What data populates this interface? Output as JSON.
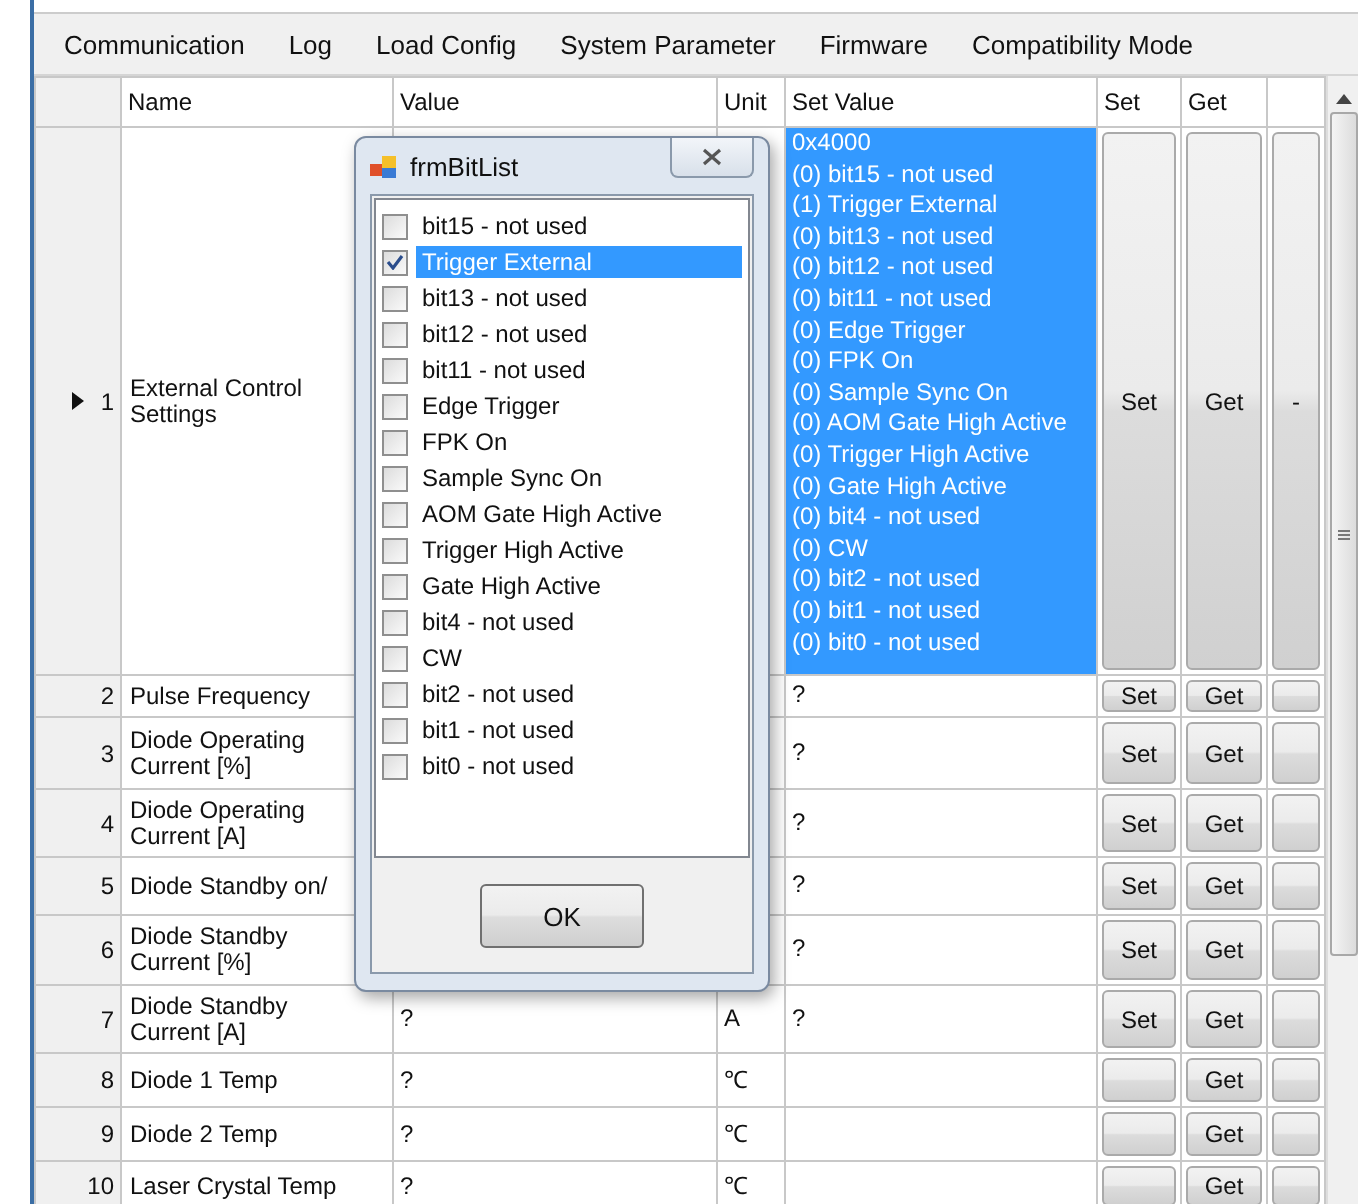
{
  "menu": [
    {
      "label": "Communication"
    },
    {
      "label": "Log"
    },
    {
      "label": "Load Config"
    },
    {
      "label": "System Parameter"
    },
    {
      "label": "Firmware"
    },
    {
      "label": "Compatibility Mode"
    }
  ],
  "table": {
    "columns": [
      "Name",
      "Value",
      "Unit",
      "Set Value",
      "Set",
      "Get"
    ],
    "rows": [
      {
        "number": "1",
        "name": "External Control Settings",
        "value": "",
        "unit": "",
        "set_value_lines": [
          "0x4000",
          "(0) bit15 - not used",
          "(1) Trigger External",
          "(0) bit13 - not used",
          "(0) bit12 - not used",
          "(0) bit11 - not used",
          "(0) Edge Trigger",
          "(0) FPK On",
          "(0) Sample Sync On",
          "(0) AOM Gate High Active",
          "(0) Trigger High Active",
          "(0) Gate High Active",
          "(0) bit4 - not used",
          "(0) CW",
          "(0) bit2 - not used",
          "(0) bit1 - not used",
          "(0) bit0 - not used"
        ],
        "set": "Set",
        "get": "Get",
        "extra": "-",
        "selected": true
      },
      {
        "number": "2",
        "name": "Pulse Frequency",
        "value": "",
        "unit": "",
        "set_value_lines": [
          "?"
        ],
        "set": "Set",
        "get": "Get",
        "extra": "",
        "selected": false
      },
      {
        "number": "3",
        "name": "Diode Operating Current [%]",
        "value": "",
        "unit": "",
        "set_value_lines": [
          "?"
        ],
        "set": "Set",
        "get": "Get",
        "extra": "",
        "selected": false
      },
      {
        "number": "4",
        "name": "Diode Operating Current [A]",
        "value": "",
        "unit": "",
        "set_value_lines": [
          "?"
        ],
        "set": "Set",
        "get": "Get",
        "extra": "",
        "selected": false
      },
      {
        "number": "5",
        "name": "Diode Standby on/",
        "value": "",
        "unit": "",
        "set_value_lines": [
          "?"
        ],
        "set": "Set",
        "get": "Get",
        "extra": "",
        "selected": false
      },
      {
        "number": "6",
        "name": "Diode Standby Current [%]",
        "value": "",
        "unit": "",
        "set_value_lines": [
          "?"
        ],
        "set": "Set",
        "get": "Get",
        "extra": "",
        "selected": false
      },
      {
        "number": "7",
        "name": "Diode Standby Current [A]",
        "value": "?",
        "unit": "A",
        "set_value_lines": [
          "?"
        ],
        "set": "Set",
        "get": "Get",
        "extra": "",
        "selected": false
      },
      {
        "number": "8",
        "name": "Diode 1 Temp",
        "value": "?",
        "unit": "℃",
        "set_value_lines": [],
        "set": "",
        "get": "Get",
        "extra": "",
        "selected": false
      },
      {
        "number": "9",
        "name": "Diode 2 Temp",
        "value": "?",
        "unit": "℃",
        "set_value_lines": [],
        "set": "",
        "get": "Get",
        "extra": "",
        "selected": false
      },
      {
        "number": "10",
        "name": "Laser Crystal Temp",
        "value": "?",
        "unit": "℃",
        "set_value_lines": [],
        "set": "",
        "get": "Get",
        "extra": "",
        "selected": false
      }
    ]
  },
  "dialog": {
    "title": "frmBitList",
    "ok": "OK",
    "items": [
      {
        "label": "bit15 - not used",
        "checked": false,
        "selected": false
      },
      {
        "label": "Trigger External",
        "checked": true,
        "selected": true
      },
      {
        "label": "bit13 - not used",
        "checked": false,
        "selected": false
      },
      {
        "label": "bit12 - not used",
        "checked": false,
        "selected": false
      },
      {
        "label": "bit11 - not used",
        "checked": false,
        "selected": false
      },
      {
        "label": "Edge Trigger",
        "checked": false,
        "selected": false
      },
      {
        "label": "FPK On",
        "checked": false,
        "selected": false
      },
      {
        "label": "Sample Sync On",
        "checked": false,
        "selected": false
      },
      {
        "label": "AOM Gate High Active",
        "checked": false,
        "selected": false
      },
      {
        "label": "Trigger High Active",
        "checked": false,
        "selected": false
      },
      {
        "label": "Gate High Active",
        "checked": false,
        "selected": false
      },
      {
        "label": "bit4 - not used",
        "checked": false,
        "selected": false
      },
      {
        "label": "CW",
        "checked": false,
        "selected": false
      },
      {
        "label": "bit2 - not used",
        "checked": false,
        "selected": false
      },
      {
        "label": "bit1 - not used",
        "checked": false,
        "selected": false
      },
      {
        "label": "bit0 - not used",
        "checked": false,
        "selected": false
      }
    ]
  }
}
